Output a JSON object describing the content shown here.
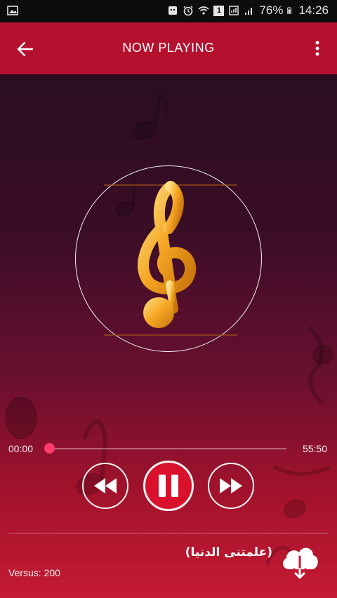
{
  "status_bar": {
    "battery": "76%",
    "time": "14:26",
    "sim_badge": "1",
    "icons": [
      "image-icon",
      "android-icon",
      "alarm-icon",
      "wifi-icon",
      "sim-icon",
      "signal-icon",
      "battery-icon"
    ]
  },
  "app_bar": {
    "title": "NOW PLAYING",
    "back_icon": "arrow-left-icon",
    "menu_icon": "more-vert-icon",
    "color": "#b5102d"
  },
  "player": {
    "artwork_icon": "treble-clef-icon",
    "current_time": "00:00",
    "total_time": "55:50",
    "progress": 0.0,
    "accent": "#ff3d68",
    "controls": {
      "rewind_icon": "rewind-icon",
      "pause_icon": "pause-icon",
      "forward_icon": "fast-forward-icon"
    }
  },
  "track": {
    "title": "(علمتنى الدنيا)",
    "version": "Versus: 200",
    "download_icon": "cloud-download-icon"
  }
}
